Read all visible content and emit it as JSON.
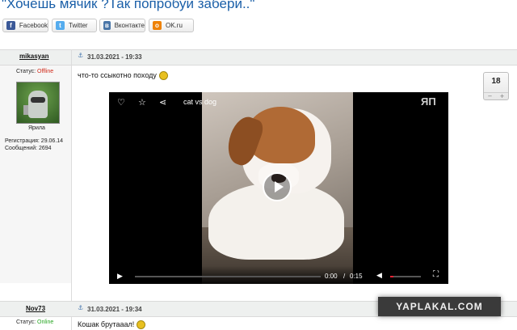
{
  "page_title": "\"Хочешь мячик ?Так попробуй забери..\"",
  "share": {
    "facebook": "Facebook",
    "twitter": "Twitter",
    "vkontakte": "Вконтакте",
    "ok": "OK.ru"
  },
  "post1": {
    "username": "mikasyan",
    "datetime": "31.03.2021 - 19:33",
    "status_label": "Статус:",
    "status_value": "Offline",
    "rank": "Ярила",
    "registered": "Регистрация: 29.06.14",
    "messages": "Сообщений: 2694",
    "text": "что-то ссыкотно походу",
    "rating": "18",
    "vote_minus": "−",
    "vote_plus": "+"
  },
  "video": {
    "title": "cat vs dog",
    "logo": "ЯП",
    "current_time": "0:00",
    "separator": "/",
    "duration": "0:15",
    "progress": 0
  },
  "post2": {
    "username": "Nov73",
    "datetime": "31.03.2021 - 19:34",
    "status_label": "Статус:",
    "status_value": "Online",
    "text": "Кошак брутааал!"
  },
  "watermark": "YAPLAKAL.COM",
  "colors": {
    "link": "#1a5fa8",
    "offline": "#d12a1a",
    "online": "#27a521",
    "facebook": "#3b5998",
    "twitter": "#55acee",
    "vk": "#4a76a8",
    "ok": "#ee8208"
  }
}
